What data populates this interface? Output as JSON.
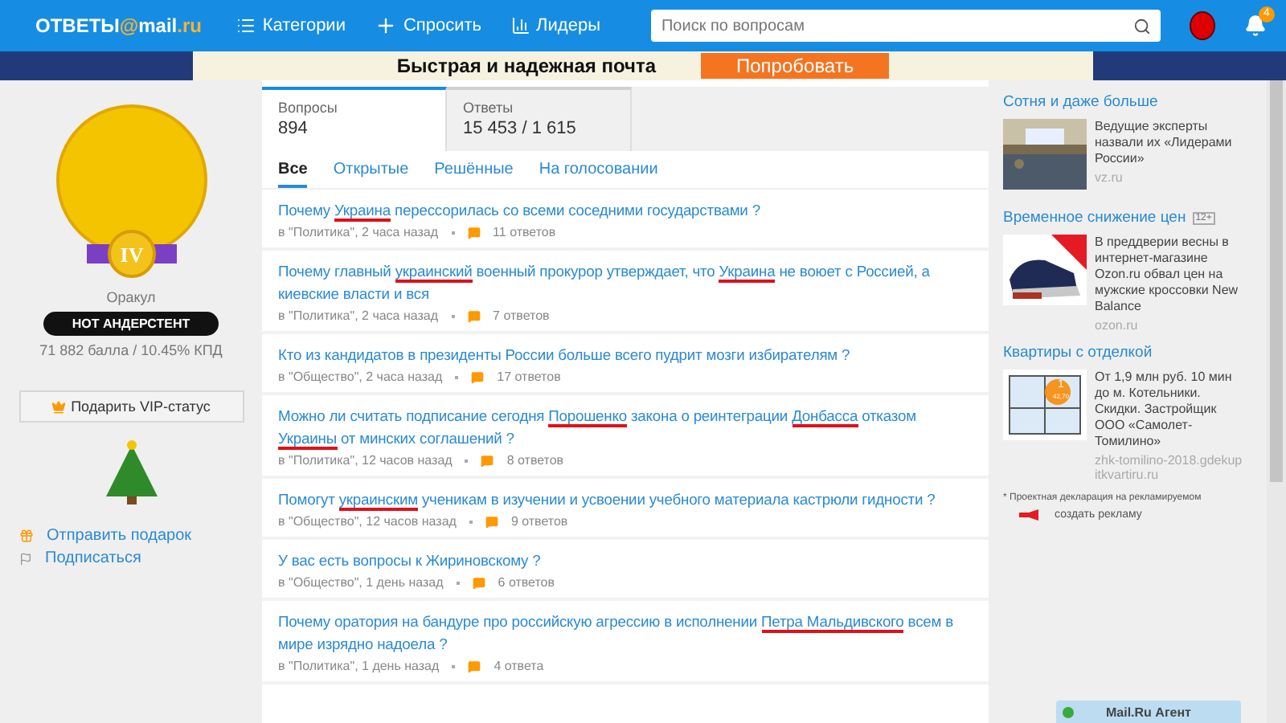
{
  "header": {
    "logo_text": "ОТВЕТЫ",
    "logo_at": "@",
    "logo_mail": "mail",
    "logo_ru": ".ru",
    "nav": [
      {
        "label": "Категории"
      },
      {
        "label": "Спросить"
      },
      {
        "label": "Лидеры"
      }
    ],
    "search": {
      "placeholder": "Поиск по вопросам"
    },
    "notifications": "4"
  },
  "banner": {
    "text": "Быстрая и надежная почта",
    "button": "Попробовать"
  },
  "profile": {
    "rank": "Оракул",
    "status": "НОТ АНДЕРСТЕНТ",
    "medal": "IV",
    "score": "71 882 балла / 10.45% КПД",
    "vip_button": "Подарить VIP-статус",
    "links": [
      {
        "label": "Отправить подарок"
      },
      {
        "label": "Подписаться"
      }
    ]
  },
  "stats": [
    {
      "label": "Вопросы",
      "value": "894",
      "selected": true
    },
    {
      "label": "Ответы",
      "value": "15 453 / 1 615",
      "selected": false
    }
  ],
  "filters": [
    {
      "label": "Все",
      "selected": true
    },
    {
      "label": "Открытые",
      "selected": false
    },
    {
      "label": "Решённые",
      "selected": false
    },
    {
      "label": "На голосовании",
      "selected": false
    }
  ],
  "questions": [
    {
      "title": [
        {
          "text": "Почему ",
          "underlined": false
        },
        {
          "text": "Украина",
          "underlined": true
        },
        {
          "text": " перессорилась со всеми соседними государствами ?",
          "underlined": false
        }
      ],
      "meta": "в \"Политика\", 2 часа назад",
      "answers": "11 ответов"
    },
    {
      "title": [
        {
          "text": "Почему главный ",
          "underlined": false
        },
        {
          "text": "украинский",
          "underlined": true
        },
        {
          "text": " военный прокурор утверждает, что ",
          "underlined": false
        },
        {
          "text": "Украина",
          "underlined": true
        },
        {
          "text": " не воюет с Россией, а киевские власти и вся",
          "underlined": false
        }
      ],
      "meta": "в \"Политика\", 2 часа назад",
      "answers": "7 ответов"
    },
    {
      "title": [
        {
          "text": "Кто из кандидатов в президенты России больше всего пудрит мозги избирателям ?",
          "underlined": false
        }
      ],
      "meta": "в \"Общество\", 2 часа назад",
      "answers": "17 ответов"
    },
    {
      "title": [
        {
          "text": "Можно ли считать подписание сегодня ",
          "underlined": false
        },
        {
          "text": "Порошенко",
          "underlined": true
        },
        {
          "text": " закона о реинтеграции ",
          "underlined": false
        },
        {
          "text": "Донбасса",
          "underlined": true
        },
        {
          "text": " отказом ",
          "underlined": false
        },
        {
          "text": "Украины",
          "underlined": true
        },
        {
          "text": " от минских соглашений ?",
          "underlined": false
        }
      ],
      "meta": "в \"Политика\", 12 часов назад",
      "answers": "8 ответов"
    },
    {
      "title": [
        {
          "text": "Помогут ",
          "underlined": false
        },
        {
          "text": "украинским",
          "underlined": true
        },
        {
          "text": " ученикам в изучении и усвоении учебного материала кастрюли гидности ?",
          "underlined": false
        }
      ],
      "meta": "в \"Общество\", 12 часов назад",
      "answers": "9 ответов"
    },
    {
      "title": [
        {
          "text": "У вас есть вопросы к Жириновскому ?",
          "underlined": false
        }
      ],
      "meta": "в \"Общество\", 1 день назад",
      "answers": "6 ответов"
    },
    {
      "title": [
        {
          "text": "Почему оратория на бандуре про российскую агрессию в исполнении ",
          "underlined": false
        },
        {
          "text": "Петра Мальдивского",
          "underlined": true
        },
        {
          "text": " всем в мире изрядно надоела ?",
          "underlined": false
        }
      ],
      "meta": "в \"Политика\", 1 день назад",
      "answers": "4 ответа"
    }
  ],
  "ads": [
    {
      "title": "Сотня и даже больше",
      "text": "Ведущие эксперты назвали их «Лидерами России»",
      "source": "vz.ru"
    },
    {
      "title": "Временное снижение цен",
      "age": "12+",
      "text": "В преддверии весны в интернет-магазине Ozon.ru обвал цен на мужские кроссовки New Balance",
      "source": "ozon.ru"
    },
    {
      "title": "Квартиры с отделкой",
      "text": "От 1,9 млн руб. 10 мин до м. Котельники. Скидки. Застройщик ООО «Самолет-Томилино»",
      "source": "zhk-tomilino-2018.gdekupitkvartiru.ru",
      "badge": "1",
      "badge_sub": "42,70"
    }
  ],
  "ad_note": "* Проектная декларация на рекламируемом",
  "create_ad": "создать рекламу",
  "agent": {
    "label": "Mail.Ru Агент"
  }
}
